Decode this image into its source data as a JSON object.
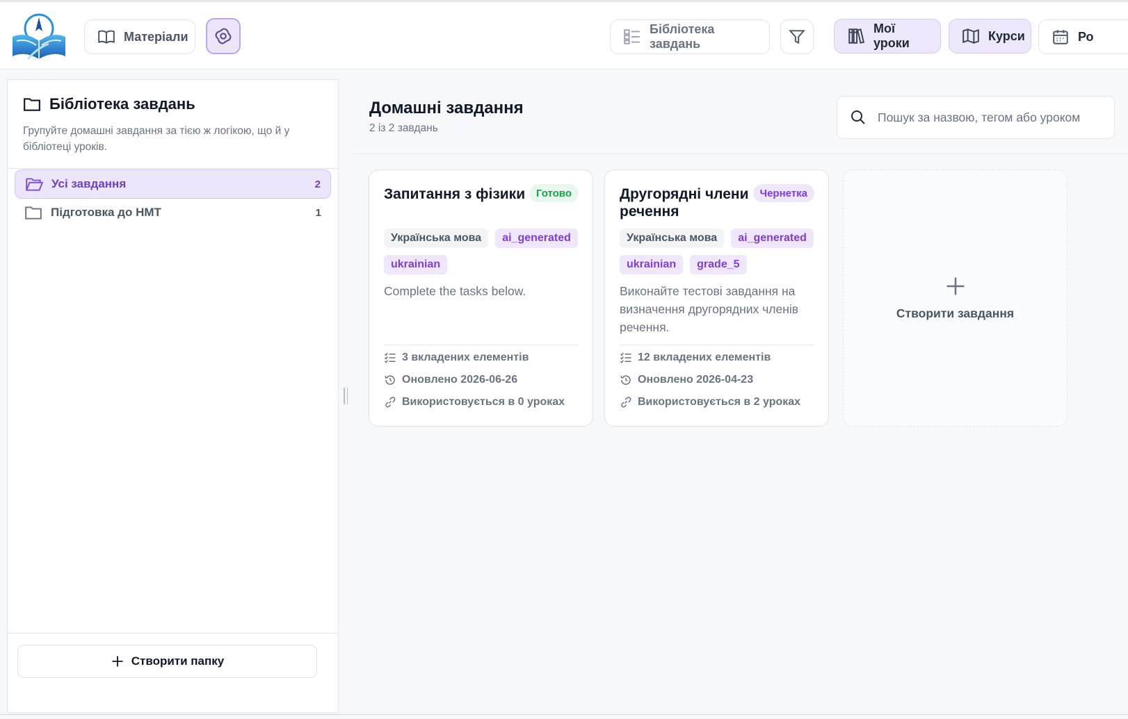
{
  "topbar": {
    "materials_label": "Матеріали",
    "library_label": "Бібліотека завдань",
    "my_lessons_label": "Мої уроки",
    "courses_label": "Курси",
    "schedule_label": "Ро"
  },
  "sidebar": {
    "title": "Бібліотека завдань",
    "description": "Групуйте домашні завдання за тією ж логікою, що й у бібліотеці уроків.",
    "folders": [
      {
        "label": "Усі завдання",
        "count": "2"
      },
      {
        "label": "Підготовка до НМТ",
        "count": "1"
      }
    ],
    "create_folder_label": "Створити папку"
  },
  "main": {
    "title": "Домашні завдання",
    "subtitle": "2 із 2 завдань",
    "search_placeholder": "Пошук за назвою, тегом або уроком",
    "cards": [
      {
        "title": "Запитання з фізики",
        "status": "Готово",
        "tags": [
          "Українська мова",
          "ai_generated",
          "ukrainian"
        ],
        "description": "Complete the tasks below.",
        "items": "3 вкладених елементів",
        "updated": "Оновлено 2026-06-26",
        "used": "Використовується в 0 уроках"
      },
      {
        "title": "Другорядні члени речення",
        "status": "Чернетка",
        "tags": [
          "Українська мова",
          "ai_generated",
          "ukrainian",
          "grade_5"
        ],
        "description": "Виконайте тестові завдання на визначення другорядних членів речення.",
        "items": "12 вкладених елементів",
        "updated": "Оновлено 2026-04-23",
        "used": "Використовується в 2 уроках"
      }
    ],
    "create_task_label": "Створити завдання"
  },
  "colors": {
    "accent": "#7c3aed",
    "accent_bg": "#ede7fb",
    "ready": "#16a34a",
    "border": "#e5e7eb"
  },
  "icons": [
    "app-logo",
    "book-open-icon",
    "ai-spiral-icon",
    "list-icon",
    "filter-icon",
    "library-books-icon",
    "map-icon",
    "calendar-icon",
    "folder-icon",
    "folder-open-icon",
    "plus-icon",
    "search-icon",
    "checklist-icon",
    "history-icon",
    "link-icon"
  ]
}
